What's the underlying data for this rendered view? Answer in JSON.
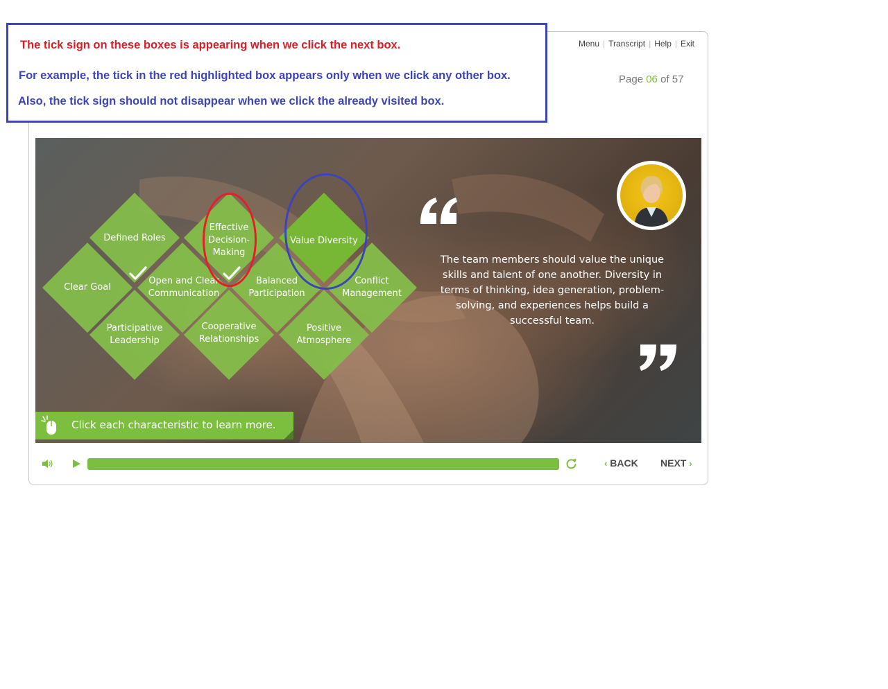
{
  "top_nav": {
    "menu": "Menu",
    "transcript": "Transcript",
    "help": "Help",
    "exit": "Exit",
    "separator": "|"
  },
  "page_info": {
    "prefix": "Page",
    "current": "06",
    "of_label": "of",
    "total": "57"
  },
  "annotation": {
    "line1": "The tick sign on these boxes is appearing when we click the next box.",
    "line2": "For example, the tick in the red highlighted box appears only when we click any other box.",
    "line3": "Also, the tick sign should not disappear when we click the already visited box.",
    "colors": {
      "red": "#d61f26",
      "blue": "#3c44b8"
    }
  },
  "slide": {
    "characteristics": [
      {
        "id": "defined-roles",
        "label": "Defined Roles",
        "visited": true,
        "active": false
      },
      {
        "id": "effective-decision-making",
        "label": "Effective Decision-Making",
        "visited": true,
        "active": false
      },
      {
        "id": "value-diversity",
        "label": "Value Diversity",
        "visited": false,
        "active": true
      },
      {
        "id": "clear-goal",
        "label": "Clear Goal",
        "visited": false,
        "active": false
      },
      {
        "id": "open-clear-communication",
        "label": "Open and Clear Communication",
        "visited": false,
        "active": false
      },
      {
        "id": "balanced-participation",
        "label": "Balanced Participation",
        "visited": false,
        "active": false
      },
      {
        "id": "conflict-management",
        "label": "Conflict Management",
        "visited": false,
        "active": false
      },
      {
        "id": "participative-leadership",
        "label": "Participative Leadership",
        "visited": false,
        "active": false
      },
      {
        "id": "cooperative-relationships",
        "label": "Cooperative Relationships",
        "visited": false,
        "active": false
      },
      {
        "id": "positive-atmosphere",
        "label": "Positive Atmosphere",
        "visited": false,
        "active": false
      }
    ],
    "quote": "The team members should value the unique skills and talent of one another. Diversity in terms of thinking, idea generation, problem-solving, and experiences helps build a successful team.",
    "hint": "Click each characteristic to learn more.",
    "accent_color": "#7cbf3f"
  },
  "controls": {
    "progress": 1.0,
    "back_label": "BACK",
    "next_label": "NEXT",
    "back_chevron": "‹",
    "next_chevron": "›"
  }
}
